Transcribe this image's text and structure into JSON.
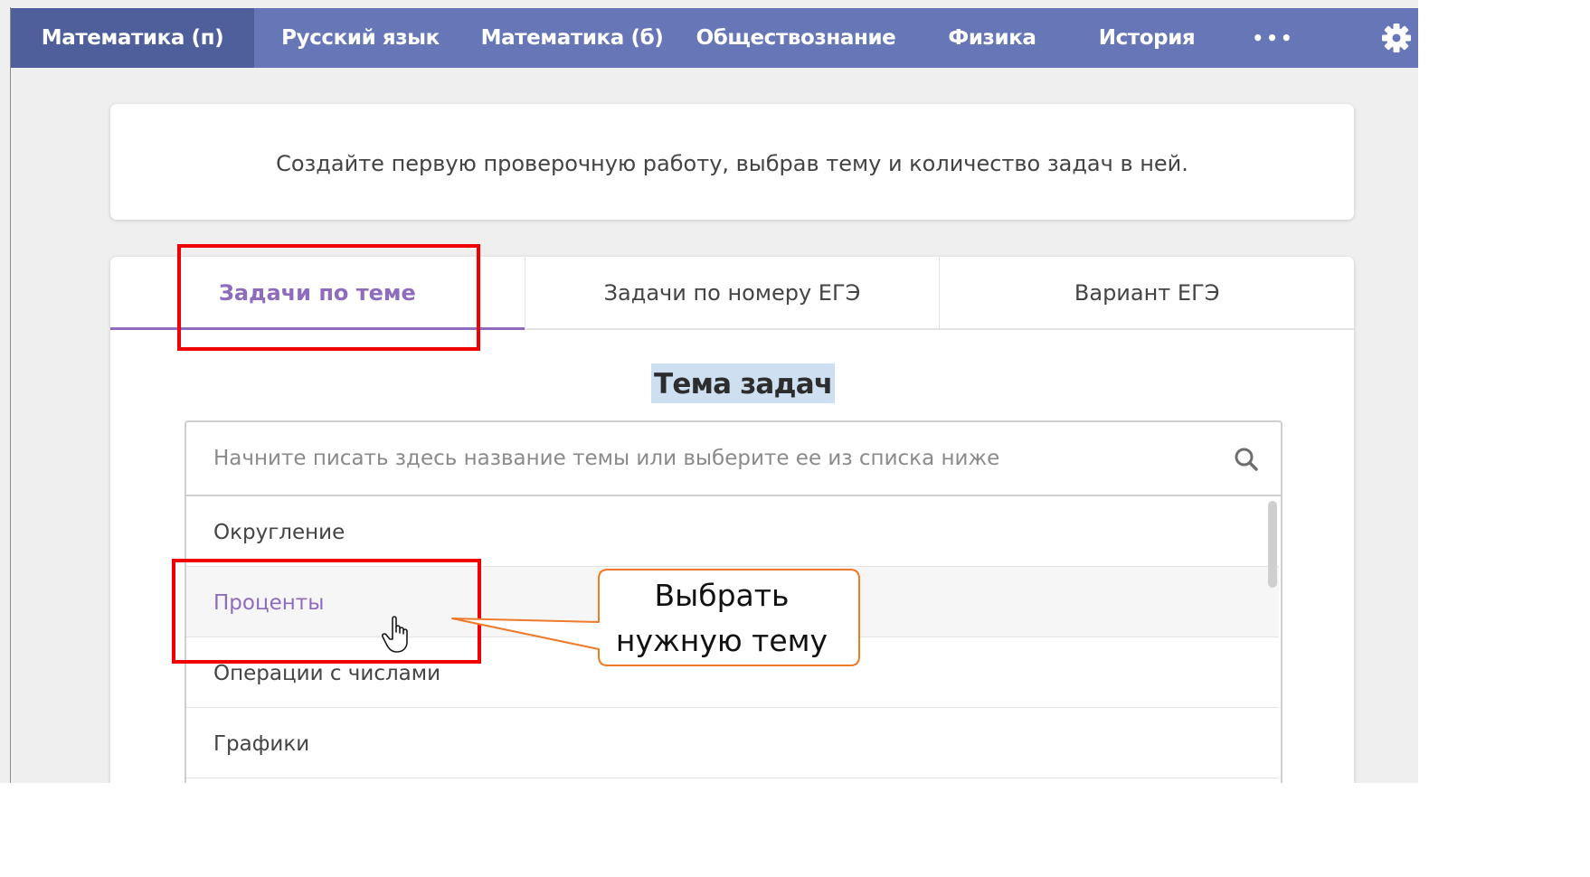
{
  "nav": {
    "items": [
      {
        "label": "Математика (п)",
        "active": true
      },
      {
        "label": "Русский язык",
        "active": false
      },
      {
        "label": "Математика (б)",
        "active": false
      },
      {
        "label": "Обществознание",
        "active": false
      },
      {
        "label": "Физика",
        "active": false
      },
      {
        "label": "История",
        "active": false
      }
    ],
    "more_label": "•••",
    "settings_icon": "gear-icon"
  },
  "intro": {
    "text": "Создайте первую проверочную работу, выбрав тему и количество задач в ней."
  },
  "tabs": [
    {
      "label": "Задачи по теме",
      "active": true
    },
    {
      "label": "Задачи по номеру ЕГЭ",
      "active": false
    },
    {
      "label": "Вариант ЕГЭ",
      "active": false
    }
  ],
  "section_title": "Тема задач",
  "search": {
    "placeholder": "Начните писать здесь название темы или выберите ее из списка ниже",
    "value": "",
    "icon": "search-icon"
  },
  "topics": [
    {
      "label": "Округление",
      "hover": false
    },
    {
      "label": "Проценты",
      "hover": true
    },
    {
      "label": "Операции с числами",
      "hover": false
    },
    {
      "label": "Графики",
      "hover": false
    }
  ],
  "annotation": {
    "callout_line1": "Выбрать",
    "callout_line2": "нужную тему",
    "highlight_color": "#f00000",
    "callout_border_color": "#ee7a2a"
  },
  "colors": {
    "navbar": "#6676b6",
    "navbar_active": "#4f5f9b",
    "accent_purple": "#8e6bbd",
    "title_highlight": "#cddff0",
    "background": "#efefef"
  }
}
